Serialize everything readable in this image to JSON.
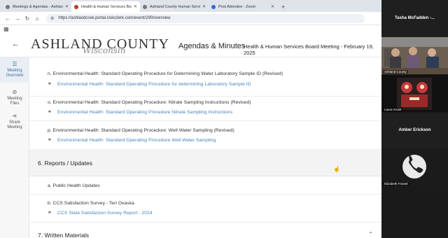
{
  "browser": {
    "tabs": [
      {
        "title": "Meetings & Agendas - Ashland",
        "active": false
      },
      {
        "title": "Health & Human Services Boa",
        "active": true
      },
      {
        "title": "Ashland County Human Servic",
        "active": false
      },
      {
        "title": "Post Attendee - Zoom",
        "active": false
      }
    ],
    "new_tab": "+",
    "url": "https://ashlandcowi.portal.civicclerk.com/event/290/overview"
  },
  "header": {
    "logo_main": "ASHLAND COUNTY",
    "logo_sub": "Wisconsin",
    "page_title": "Agendas & Minutes",
    "meeting_title": "Health & Human Services Board Meeting - February 19, 2025"
  },
  "rail": {
    "items": [
      {
        "label_1": "Meeting",
        "label_2": "Overview"
      },
      {
        "label_1": "Meeting",
        "label_2": "Files"
      },
      {
        "label_1": "Share",
        "label_2": "Meeting"
      }
    ]
  },
  "content": {
    "item_n": {
      "title": "n. Environmental Health: Standard Operating Procedure for Determining Water Laboratory Sample ID (Revised)",
      "link": "Environmental Health: Standard Operating Procedure for determining Laboratory Sample ID"
    },
    "item_o": {
      "title": "o. Environmental Health: Standard Operating Procedure: Nitrate Sampling Instructions (Revised)",
      "link": "Environmental Health: Standard Operating Procedure Nitrate Sampling Instructions"
    },
    "item_p": {
      "title": "p. Environmental Health: Standard Operating Procedure: Well Water Sampling (Revised)",
      "link": "Environmental Health: Standard Operating Procedure Well Water Sampling"
    },
    "section_6": "6. Reports / Updates",
    "item_6a": {
      "title": "a. Public Health Updates"
    },
    "item_6b": {
      "title": "b. CCS Satisfaction Survey - Teri Ovaska",
      "link": "CCS State Satisfaction Survey Report - 2024"
    },
    "section_7": "7. Written Materials"
  },
  "zoom": {
    "tiles": [
      {
        "name": "Tasha McFadden -...",
        "caption": ""
      },
      {
        "name": "",
        "caption": "Ashland County"
      },
      {
        "name": "",
        "caption": "Laura Kruse"
      },
      {
        "name": "Amber Erickson",
        "caption": ""
      },
      {
        "name": "",
        "caption": "Elizabeth Franek"
      }
    ]
  }
}
